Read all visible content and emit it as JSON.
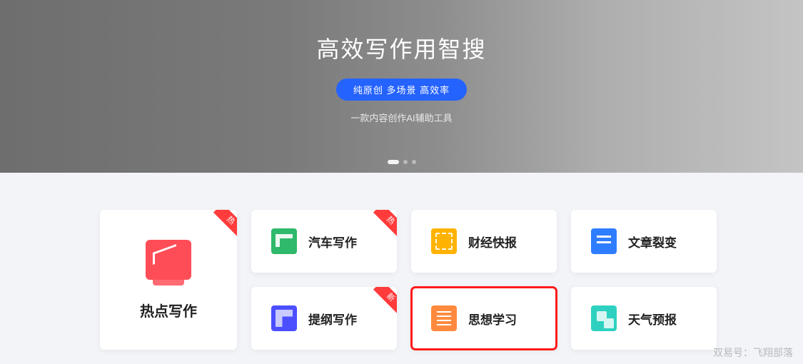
{
  "hero": {
    "title": "高效写作用智搜",
    "pill": "纯原创 多场景 高效率",
    "subtitle": "一款内容创作AI辅助工具"
  },
  "ribbons": {
    "hot": "热",
    "new": "新"
  },
  "cards": {
    "big": {
      "label": "热点写作"
    },
    "small": [
      {
        "label": "汽车写作",
        "icon": "green",
        "ribbon": "hot"
      },
      {
        "label": "财经快报",
        "icon": "yellow",
        "ribbon": null
      },
      {
        "label": "文章裂变",
        "icon": "blue",
        "ribbon": null
      },
      {
        "label": "提纲写作",
        "icon": "purple",
        "ribbon": "new"
      },
      {
        "label": "思想学习",
        "icon": "orange",
        "ribbon": null
      },
      {
        "label": "天气预报",
        "icon": "teal",
        "ribbon": null
      }
    ]
  },
  "highlight_index": 4,
  "watermark": "双易号：飞翔部落"
}
